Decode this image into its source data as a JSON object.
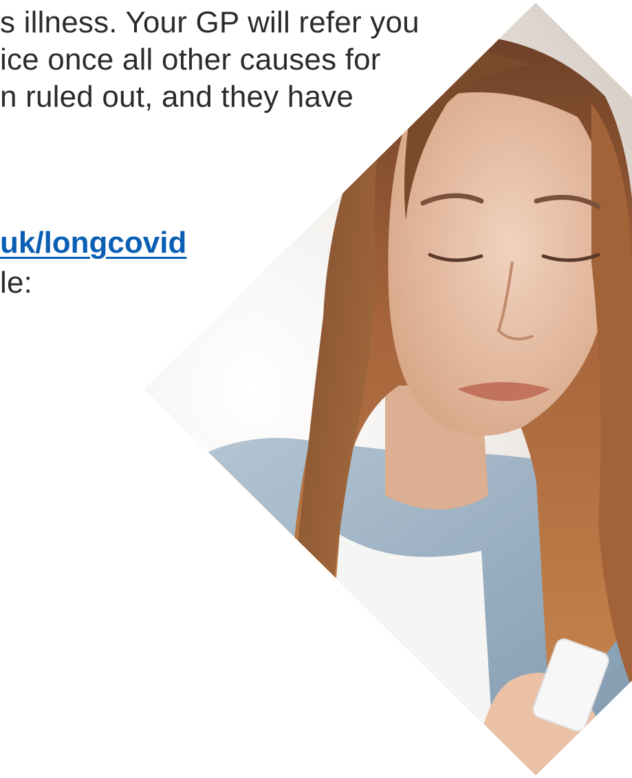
{
  "document": {
    "paragraph_lines": [
      "s illness. Your GP will refer you",
      "ice once all other causes for",
      "n ruled out, and they have"
    ],
    "link_text": "uk/longcovid",
    "trailing_text": "le:"
  },
  "photo": {
    "icon": "woman-looking-at-phone-photo",
    "colors": {
      "hair": "#a8683a",
      "skin": "#e8c2a8",
      "denim": "#9db3c6",
      "tshirt": "#f4f4f4",
      "background": "#efeae5"
    }
  },
  "colors": {
    "text": "#2b2b2b",
    "link": "#0a5fb4",
    "background": "#ffffff"
  }
}
